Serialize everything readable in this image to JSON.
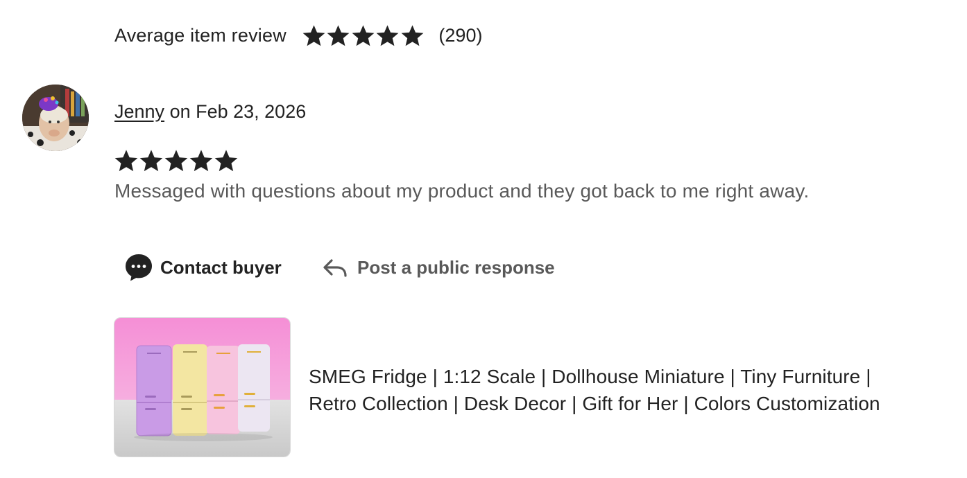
{
  "average_review": {
    "label": "Average item review",
    "rating": 5,
    "count_text": "(290)"
  },
  "review": {
    "reviewer_name": "Jenny",
    "date_text": " on Feb 23, 2026",
    "rating": 5,
    "text": "Messaged with questions about my product and they got back to me right away."
  },
  "actions": {
    "contact_label": "Contact buyer",
    "respond_label": "Post a public response"
  },
  "product": {
    "title_line1": "SMEG Fridge | 1:12 Scale | Dollhouse Miniature | Tiny Furniture |",
    "title_line2": "Retro Collection | Desk Decor | Gift for Her | Colors Customization",
    "fridge_colors": [
      "#c99be6",
      "#f3e6a2",
      "#f7c4de",
      "#ece6f2"
    ],
    "handle_colors": [
      "#b48ad0",
      "#c9b86a",
      "#e7a03c",
      "#e0b03a"
    ]
  },
  "icons": {
    "star": "star-icon",
    "contact": "speech-bubble-icon",
    "respond": "reply-arrow-icon"
  },
  "colors": {
    "text_primary": "#222222",
    "text_secondary": "#595959",
    "thumb_wall": "#f39ad7",
    "thumb_table": "#d4d4d4"
  }
}
